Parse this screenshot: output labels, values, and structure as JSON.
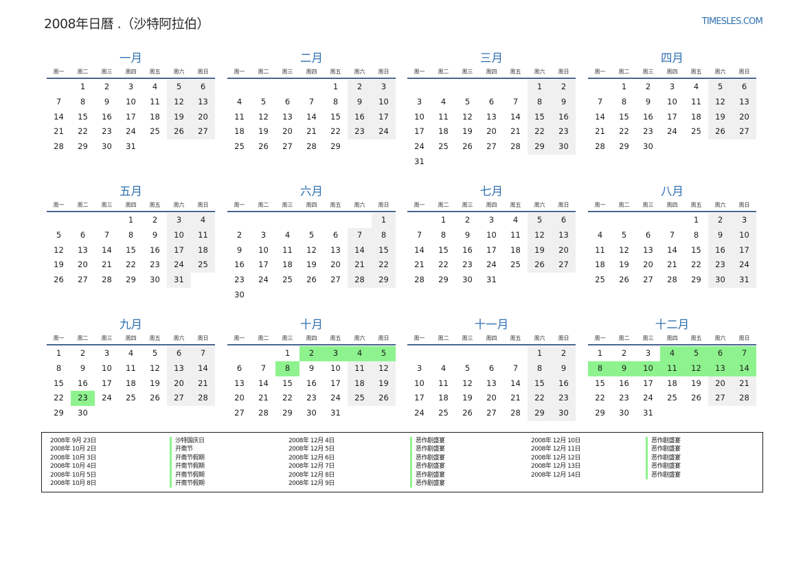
{
  "header": {
    "title": "2008年日曆 .（沙特阿拉伯）",
    "site": "TIMESLES.COM"
  },
  "weekdays": [
    "周一",
    "周二",
    "周三",
    "周四",
    "周五",
    "周六",
    "周日"
  ],
  "colors": {
    "accent": "#2e6fb0",
    "holiday": "#8ef38e",
    "weekend": "#f0f0f0",
    "rule": "#46648c"
  },
  "months": [
    {
      "name": "一月",
      "offset": 1,
      "days": 31,
      "holidays": []
    },
    {
      "name": "二月",
      "offset": 4,
      "days": 29,
      "holidays": []
    },
    {
      "name": "三月",
      "offset": 5,
      "days": 31,
      "holidays": []
    },
    {
      "name": "四月",
      "offset": 1,
      "days": 30,
      "holidays": []
    },
    {
      "name": "五月",
      "offset": 3,
      "days": 31,
      "holidays": []
    },
    {
      "name": "六月",
      "offset": 6,
      "days": 30,
      "holidays": []
    },
    {
      "name": "七月",
      "offset": 1,
      "days": 31,
      "holidays": []
    },
    {
      "name": "八月",
      "offset": 4,
      "days": 31,
      "holidays": []
    },
    {
      "name": "九月",
      "offset": 0,
      "days": 30,
      "holidays": [
        23
      ]
    },
    {
      "name": "十月",
      "offset": 2,
      "days": 31,
      "holidays": [
        2,
        3,
        4,
        5,
        8
      ]
    },
    {
      "name": "十一月",
      "offset": 5,
      "days": 30,
      "holidays": []
    },
    {
      "name": "十二月",
      "offset": 0,
      "days": 31,
      "holidays": [
        4,
        5,
        6,
        7,
        8,
        9,
        10,
        11,
        12,
        13,
        14
      ]
    }
  ],
  "holidays": [
    {
      "date": "2008年 9月 23日",
      "name": "沙特国庆日"
    },
    {
      "date": "2008年 10月 2日",
      "name": "开斋节"
    },
    {
      "date": "2008年 10月 3日",
      "name": "开斋节假期"
    },
    {
      "date": "2008年 10月 4日",
      "name": "开斋节假期"
    },
    {
      "date": "2008年 10月 5日",
      "name": "开斋节假期"
    },
    {
      "date": "2008年 10月 8日",
      "name": "开斋节假期"
    },
    {
      "date": "2008年 12月 4日",
      "name": "恶作剧盛宴"
    },
    {
      "date": "2008年 12月 5日",
      "name": "恶作剧盛宴"
    },
    {
      "date": "2008年 12月 6日",
      "name": "恶作剧盛宴"
    },
    {
      "date": "2008年 12月 7日",
      "name": "恶作剧盛宴"
    },
    {
      "date": "2008年 12月 8日",
      "name": "恶作剧盛宴"
    },
    {
      "date": "2008年 12月 9日",
      "name": "恶作剧盛宴"
    },
    {
      "date": "2008年 12月 10日",
      "name": "恶作剧盛宴"
    },
    {
      "date": "2008年 12月 11日",
      "name": "恶作剧盛宴"
    },
    {
      "date": "2008年 12月 12日",
      "name": "恶作剧盛宴"
    },
    {
      "date": "2008年 12月 13日",
      "name": "恶作剧盛宴"
    },
    {
      "date": "2008年 12月 14日",
      "name": "恶作剧盛宴"
    }
  ]
}
